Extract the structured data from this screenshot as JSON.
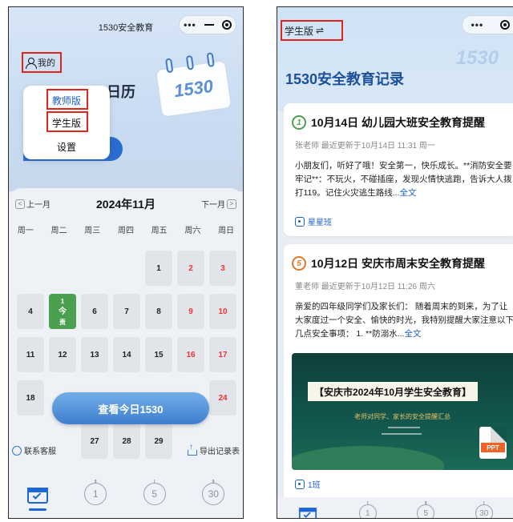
{
  "left": {
    "title": "1530安全教育",
    "my_label": "我的",
    "hero_partial": "日历",
    "deco_num": "1530",
    "menu": {
      "teacher": "教师版",
      "student": "学生版",
      "settings": "设置"
    },
    "prev_month": "上一月",
    "next_month": "下一月",
    "month_title": "2024年11月",
    "weekdays": [
      "周一",
      "周二",
      "周三",
      "周四",
      "周五",
      "周六",
      "周日"
    ],
    "today_label": "今",
    "today_sub": "责",
    "today_top": "1",
    "check_today": "查看今日1530",
    "contact": "联系客服",
    "export": "导出记录表",
    "tabs": [
      "1",
      "5",
      "30"
    ],
    "days": {
      "r1": [
        "1",
        "2",
        "3"
      ],
      "r2": [
        "4",
        "6",
        "7",
        "8",
        "9",
        "10"
      ],
      "r3": [
        "11",
        "12",
        "13",
        "14",
        "15",
        "16",
        "17"
      ],
      "r4": [
        "18",
        "24"
      ],
      "r5": [
        "27",
        "28",
        "29"
      ]
    }
  },
  "right": {
    "version": "学生版",
    "title": "1530安全教育记录",
    "watermark": "1530",
    "cards": [
      {
        "badge": "1",
        "title": "10月14日 幼儿园大班安全教育提醒",
        "meta": "张老师  最近更新于10月14日 11:31  周一",
        "body": "小朋友们，听好了哦！安全第一，快乐成长。**消防安全要牢记**：不玩火，不碰插座，发现火情快逃跑，告诉大人拨打119。记住火灾逃生路线...",
        "more": "全文",
        "tag": "星星班"
      },
      {
        "badge": "5",
        "title": "10月12日 安庆市周末安全教育提醒",
        "meta": "董老师  最近更新于10月12日 11:26  周六",
        "body": "亲爱的四年级同学们及家长们：  随着周末的到来，为了让大家度过一个安全、愉快的时光，我特别提醒大家注意以下几点安全事项： 1. **防溺水...",
        "more": "全文",
        "banner_title": "【安庆市2024年10月学生安全教育】",
        "banner_sub": "老师对同学、家长的安全提醒汇总",
        "ppt": "PPT",
        "tag": "1班"
      }
    ],
    "tabs": [
      "1",
      "5",
      "30"
    ]
  }
}
